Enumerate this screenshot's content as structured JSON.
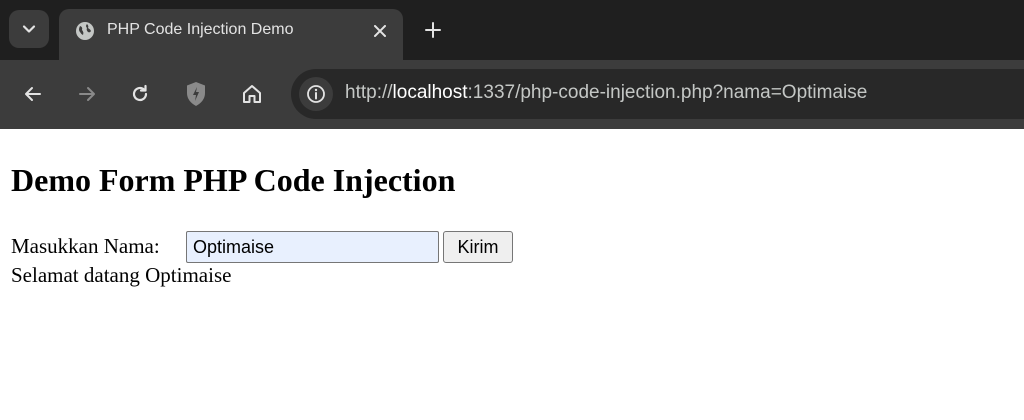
{
  "browser": {
    "tab": {
      "title": "PHP Code Injection Demo",
      "favicon": "globe-icon"
    },
    "url": {
      "scheme": "http://",
      "host": "localhost",
      "rest": ":1337/php-code-injection.php?nama=Optimaise"
    },
    "icons": {
      "tab_search": "chevron-down-icon",
      "close": "close-icon",
      "new_tab": "plus-icon",
      "back": "back-arrow-icon",
      "forward": "forward-arrow-icon",
      "reload": "reload-icon",
      "extension": "shield-icon",
      "home": "home-icon",
      "site_info": "info-icon"
    },
    "colors": {
      "tabstrip": "#1f1f1f",
      "toolbar": "#3c3c3c",
      "omnibox": "#282828"
    }
  },
  "page": {
    "title": "Demo Form PHP Code Injection",
    "form": {
      "label": "Masukkan Nama:",
      "input_value": "Optimaise",
      "submit_label": "Kirim"
    },
    "greeting": "Selamat datang Optimaise"
  }
}
